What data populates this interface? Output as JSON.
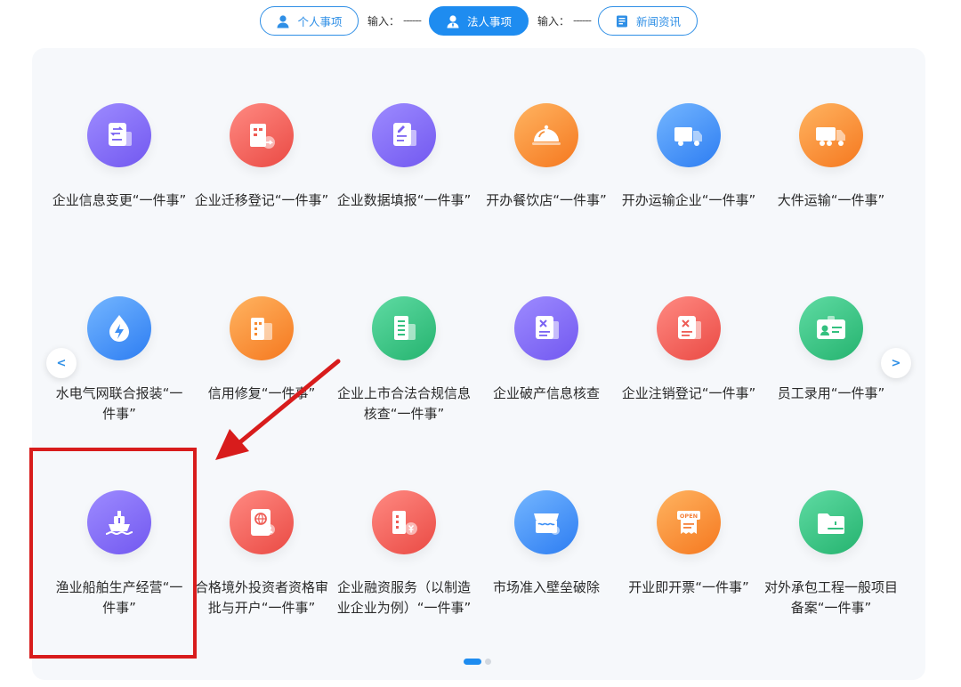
{
  "tabs": {
    "personal": {
      "label": "个人事项",
      "icon": "user-icon"
    },
    "input_1": {
      "label": "输入：",
      "value": "------"
    },
    "legal": {
      "label": "法人事项",
      "icon": "user-icon"
    },
    "input_2": {
      "label": "输入：",
      "value": "------"
    },
    "news": {
      "label": "新闻资讯",
      "icon": "news-icon"
    },
    "active": "legal"
  },
  "colors": {
    "accent": "#1e8cf0",
    "highlight": "#d81c1c"
  },
  "items": [
    {
      "label": "企业信息变更“一件事”",
      "icon": "document-swap-icon",
      "color": "purple"
    },
    {
      "label": "企业迁移登记“一件事”",
      "icon": "building-move-icon",
      "color": "red"
    },
    {
      "label": "企业数据填报“一件事”",
      "icon": "form-edit-icon",
      "color": "purple"
    },
    {
      "label": "开办餐饮店“一件事”",
      "icon": "food-cloche-icon",
      "color": "orange"
    },
    {
      "label": "开办运输企业“一件事”",
      "icon": "truck-icon",
      "color": "blue"
    },
    {
      "label": "大件运输“一件事”",
      "icon": "heavy-truck-icon",
      "color": "orange"
    },
    {
      "label": "水电气网联合报装“一件事”",
      "icon": "utility-drop-icon",
      "color": "blue"
    },
    {
      "label": "信用修复“一件事”",
      "icon": "building-icon",
      "color": "orange"
    },
    {
      "label": "企业上市合法合规信息核查“一件事”",
      "icon": "office-building-icon",
      "color": "green"
    },
    {
      "label": "企业破产信息核查",
      "icon": "document-x-icon",
      "color": "purple"
    },
    {
      "label": "企业注销登记“一件事”",
      "icon": "document-cancel-icon",
      "color": "red"
    },
    {
      "label": "员工录用“一件事”",
      "icon": "id-card-icon",
      "color": "green"
    },
    {
      "label": "渔业船舶生产经营“一件事”",
      "icon": "ship-icon",
      "color": "purple"
    },
    {
      "label": "合格境外投资者资格审批与开户“一件事”",
      "icon": "passport-icon",
      "color": "red"
    },
    {
      "label": "企业融资服务（以制造业企业为例）“一件事”",
      "icon": "finance-building-icon",
      "color": "red"
    },
    {
      "label": "市场准入壁垒破除",
      "icon": "store-icon",
      "color": "blue"
    },
    {
      "label": "开业即开票“一件事”",
      "icon": "open-sign-icon",
      "color": "orange",
      "badge": "OPEN"
    },
    {
      "label": "对外承包工程一般项目备案“一件事”",
      "icon": "folder-helmet-icon",
      "color": "green"
    }
  ],
  "carousel": {
    "prev_icon": "chevron-left-icon",
    "next_icon": "chevron-right-icon",
    "prev_label": "<",
    "next_label": ">",
    "page_count": 2,
    "current_page": 1
  }
}
